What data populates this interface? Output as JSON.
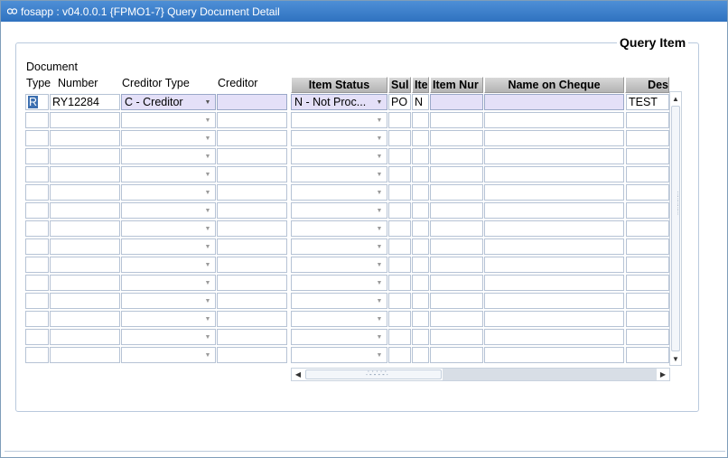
{
  "window": {
    "title": "fosapp : v04.0.0.1  {FPMO1-7} Query Document Detail",
    "accent_color": "#2f72c0"
  },
  "section": {
    "title": "Query Item"
  },
  "left_headers": {
    "document": "Document",
    "type": "Type",
    "number": "Number",
    "creditor_type": "Creditor Type",
    "creditor": "Creditor"
  },
  "right_headers": {
    "item_status": "Item Status",
    "sub": "Sul",
    "item": "Ite",
    "item_number": "Item Nur",
    "name_on_cheque": "Name on Cheque",
    "description": "Des"
  },
  "rows": [
    {
      "type": "R",
      "number": "RY12284",
      "creditor_type": "C - Creditor",
      "creditor": "",
      "item_status": "N - Not Proc...",
      "sub": "PO",
      "item": "N",
      "item_number": "",
      "name_on_cheque": "",
      "description": "TEST"
    },
    {
      "type": "",
      "number": "",
      "creditor_type": "",
      "creditor": "",
      "item_status": "",
      "sub": "",
      "item": "",
      "item_number": "",
      "name_on_cheque": "",
      "description": ""
    },
    {
      "type": "",
      "number": "",
      "creditor_type": "",
      "creditor": "",
      "item_status": "",
      "sub": "",
      "item": "",
      "item_number": "",
      "name_on_cheque": "",
      "description": ""
    },
    {
      "type": "",
      "number": "",
      "creditor_type": "",
      "creditor": "",
      "item_status": "",
      "sub": "",
      "item": "",
      "item_number": "",
      "name_on_cheque": "",
      "description": ""
    },
    {
      "type": "",
      "number": "",
      "creditor_type": "",
      "creditor": "",
      "item_status": "",
      "sub": "",
      "item": "",
      "item_number": "",
      "name_on_cheque": "",
      "description": ""
    },
    {
      "type": "",
      "number": "",
      "creditor_type": "",
      "creditor": "",
      "item_status": "",
      "sub": "",
      "item": "",
      "item_number": "",
      "name_on_cheque": "",
      "description": ""
    },
    {
      "type": "",
      "number": "",
      "creditor_type": "",
      "creditor": "",
      "item_status": "",
      "sub": "",
      "item": "",
      "item_number": "",
      "name_on_cheque": "",
      "description": ""
    },
    {
      "type": "",
      "number": "",
      "creditor_type": "",
      "creditor": "",
      "item_status": "",
      "sub": "",
      "item": "",
      "item_number": "",
      "name_on_cheque": "",
      "description": ""
    },
    {
      "type": "",
      "number": "",
      "creditor_type": "",
      "creditor": "",
      "item_status": "",
      "sub": "",
      "item": "",
      "item_number": "",
      "name_on_cheque": "",
      "description": ""
    },
    {
      "type": "",
      "number": "",
      "creditor_type": "",
      "creditor": "",
      "item_status": "",
      "sub": "",
      "item": "",
      "item_number": "",
      "name_on_cheque": "",
      "description": ""
    },
    {
      "type": "",
      "number": "",
      "creditor_type": "",
      "creditor": "",
      "item_status": "",
      "sub": "",
      "item": "",
      "item_number": "",
      "name_on_cheque": "",
      "description": ""
    },
    {
      "type": "",
      "number": "",
      "creditor_type": "",
      "creditor": "",
      "item_status": "",
      "sub": "",
      "item": "",
      "item_number": "",
      "name_on_cheque": "",
      "description": ""
    },
    {
      "type": "",
      "number": "",
      "creditor_type": "",
      "creditor": "",
      "item_status": "",
      "sub": "",
      "item": "",
      "item_number": "",
      "name_on_cheque": "",
      "description": ""
    },
    {
      "type": "",
      "number": "",
      "creditor_type": "",
      "creditor": "",
      "item_status": "",
      "sub": "",
      "item": "",
      "item_number": "",
      "name_on_cheque": "",
      "description": ""
    },
    {
      "type": "",
      "number": "",
      "creditor_type": "",
      "creditor": "",
      "item_status": "",
      "sub": "",
      "item": "",
      "item_number": "",
      "name_on_cheque": "",
      "description": ""
    }
  ],
  "icons": {
    "app": "app-icon",
    "dropdown": "chevron-down-icon",
    "scroll_up": "scroll-up-arrow-icon",
    "scroll_down": "scroll-down-arrow-icon",
    "scroll_left": "scroll-left-arrow-icon",
    "scroll_right": "scroll-right-arrow-icon"
  }
}
